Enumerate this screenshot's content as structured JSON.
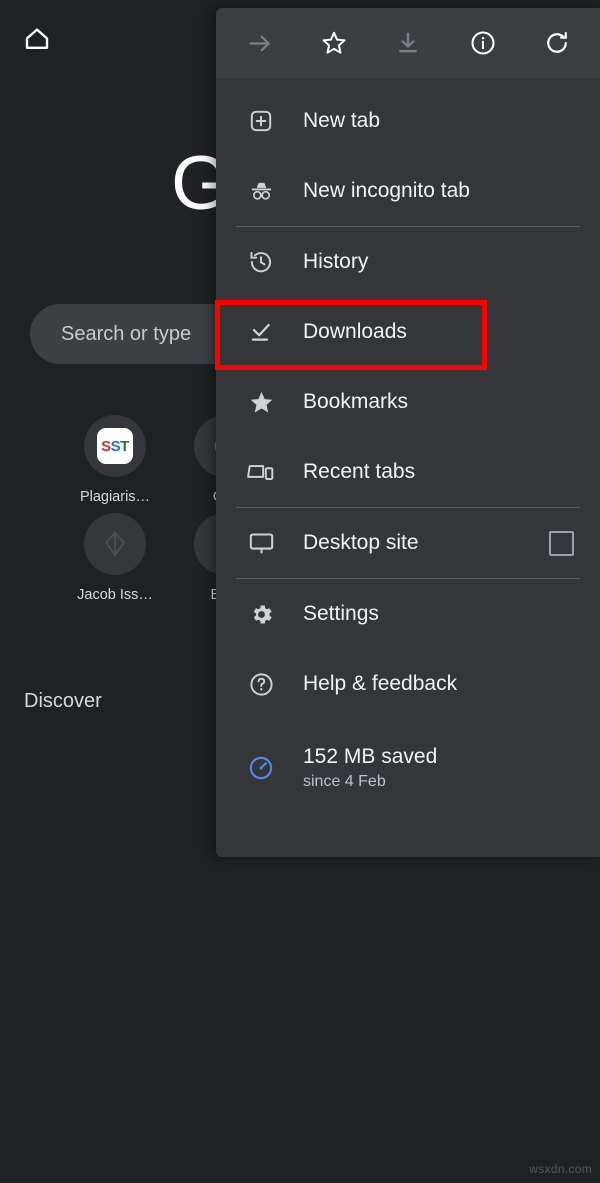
{
  "background_page": {
    "home_icon": "home-icon",
    "logo_text": "G",
    "search": {
      "placeholder": "Search or type ",
      "value": "Search or type "
    },
    "tiles": [
      {
        "label": "Plagiaris…",
        "icon": "sst-badge-icon"
      },
      {
        "label": "Gra",
        "icon": "grammarly-icon"
      },
      {
        "label": "Jacob Iss…",
        "icon": "diamond-icon"
      },
      {
        "label": "Blog",
        "icon": "blog-icon"
      }
    ],
    "sst_badge": {
      "l1": "S",
      "l2": "S",
      "l3": "T"
    },
    "discover_heading": "Discover"
  },
  "menu": {
    "header_actions": [
      {
        "name": "forward-arrow-icon",
        "label": "Forward",
        "disabled": true
      },
      {
        "name": "star-icon",
        "label": "Bookmark",
        "disabled": false
      },
      {
        "name": "download-icon",
        "label": "Download page",
        "disabled": true
      },
      {
        "name": "info-circle-icon",
        "label": "Page info",
        "disabled": false
      },
      {
        "name": "reload-icon",
        "label": "Reload",
        "disabled": false
      }
    ],
    "items": [
      {
        "label": "New tab",
        "icon": "new-tab-icon"
      },
      {
        "label": "New incognito tab",
        "icon": "incognito-icon"
      },
      {
        "label": "History",
        "icon": "history-icon"
      },
      {
        "label": "Downloads",
        "icon": "downloads-icon",
        "highlighted": true
      },
      {
        "label": "Bookmarks",
        "icon": "star-filled-icon"
      },
      {
        "label": "Recent tabs",
        "icon": "recent-tabs-icon"
      },
      {
        "label": "Desktop site",
        "icon": "desktop-icon",
        "checkbox": false
      },
      {
        "label": "Settings",
        "icon": "gear-icon"
      },
      {
        "label": "Help & feedback",
        "icon": "help-circle-icon"
      }
    ],
    "data_saver": {
      "title": "152 MB saved",
      "subtitle": "since 4 Feb",
      "icon": "data-saver-icon",
      "accent_color": "#4f8cf0"
    }
  },
  "highlight": {
    "target": "Downloads",
    "color": "#ff0000"
  },
  "watermark": "wsxdn.com",
  "colors": {
    "page_bg": "#202124",
    "menu_bg": "#35363a",
    "menu_header_bg": "#3c3d41",
    "text_primary": "#f1f2f3",
    "text_secondary": "#bdc1c6",
    "divider": "#5a5c60",
    "highlight_red": "#ff0000"
  }
}
